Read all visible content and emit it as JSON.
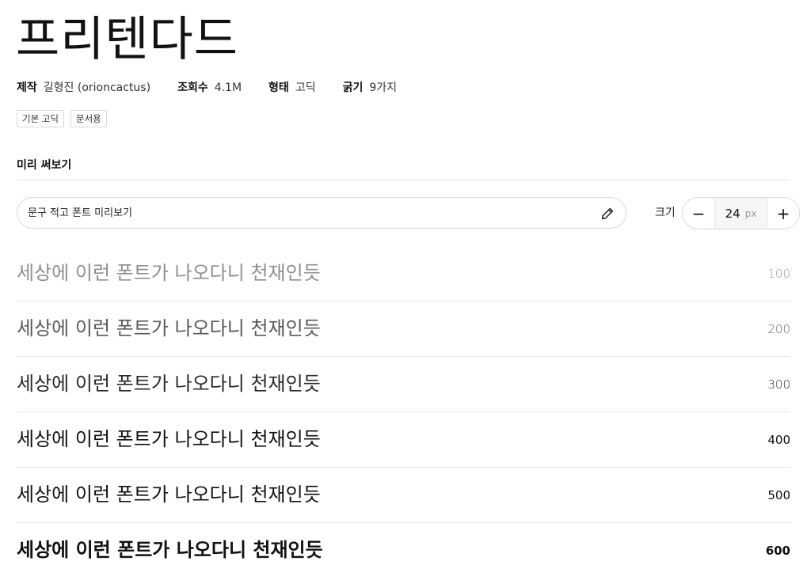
{
  "font": {
    "name": "프리텐다드",
    "meta": [
      {
        "label": "제작",
        "value": "길형진 (orioncactus)"
      },
      {
        "label": "조회수",
        "value": "4.1M"
      },
      {
        "label": "형태",
        "value": "고딕"
      },
      {
        "label": "굵기",
        "value": "9가지"
      }
    ],
    "tags": [
      "기본 고딕",
      "문서용"
    ]
  },
  "preview": {
    "section_title": "미리 써보기",
    "input_placeholder": "문구 적고 폰트 미리보기",
    "input_value": "",
    "size_label": "크기",
    "size_value": "24",
    "size_unit": "px",
    "decrement_label": "−",
    "increment_label": "+"
  },
  "icons": {
    "edit": "pencil-icon"
  },
  "weights": [
    {
      "sample": "세상에 이런 폰트가 나오다니 천재인듯",
      "weight": "100",
      "text_color": "#8f8f8f",
      "num_color": "#9a9a9a"
    },
    {
      "sample": "세상에 이런 폰트가 나오다니 천재인듯",
      "weight": "200",
      "text_color": "#5a5a5a",
      "num_color": "#6a6a6a"
    },
    {
      "sample": "세상에 이런 폰트가 나오다니 천재인듯",
      "weight": "300",
      "text_color": "#2a2a2a",
      "num_color": "#333333"
    },
    {
      "sample": "세상에 이런 폰트가 나오다니 천재인듯",
      "weight": "400",
      "text_color": "#111111",
      "num_color": "#111111"
    },
    {
      "sample": "세상에 이런 폰트가 나오다니 천재인듯",
      "weight": "500",
      "text_color": "#111111",
      "num_color": "#111111"
    },
    {
      "sample": "세상에 이런 폰트가 나오다니 천재인듯",
      "weight": "600",
      "text_color": "#111111",
      "num_color": "#111111"
    }
  ]
}
